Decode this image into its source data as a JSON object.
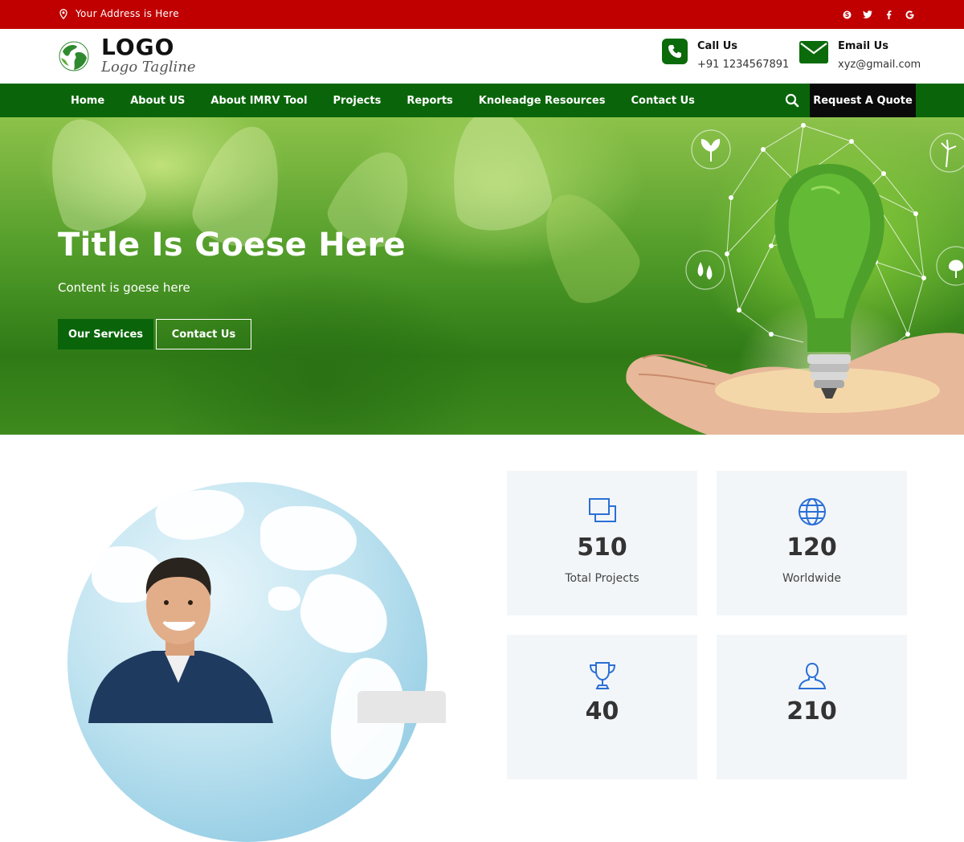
{
  "topbar": {
    "address": "Your Address is Here",
    "social": [
      "skype-icon",
      "twitter-icon",
      "facebook-icon",
      "google-icon"
    ]
  },
  "header": {
    "logo_title": "LOGO",
    "logo_tagline": "Logo Tagline",
    "call_label": "Call Us",
    "call_value": "+91 1234567891",
    "email_label": "Email Us",
    "email_value": "xyz@gmail.com"
  },
  "nav": {
    "items": [
      "Home",
      "About US",
      "About IMRV Tool",
      "Projects",
      "Reports",
      "Knoleadge Resources",
      "Contact Us"
    ],
    "quote_label": "Request A Quote"
  },
  "hero": {
    "title": "Title Is Goese Here",
    "subtitle": "Content is goese here",
    "btn_services": "Our Services",
    "btn_contact": "Contact Us"
  },
  "stats": [
    {
      "value": "510",
      "label": "Total Projects",
      "icon": "projects-icon"
    },
    {
      "value": "120",
      "label": "Worldwide",
      "icon": "globe-icon"
    },
    {
      "value": "40",
      "label": "",
      "icon": "trophy-icon"
    },
    {
      "value": "210",
      "label": "",
      "icon": "user-icon"
    }
  ],
  "colors": {
    "topbar": "#c00000",
    "nav": "#0a650a",
    "quote_button": "#0a0a0a",
    "stat_icon": "#2a6fd6",
    "stat_bg": "#f3f6f9"
  }
}
